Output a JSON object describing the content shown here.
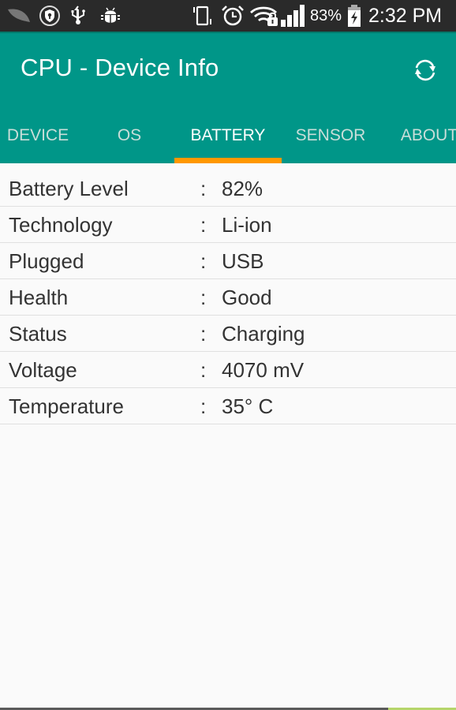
{
  "status_bar": {
    "left_icons": [
      "leaf-icon",
      "shield-lock-icon",
      "usb-icon",
      "android-debug-icon"
    ],
    "right_icons": [
      "vibrate-icon",
      "alarm-icon",
      "wifi-locked-icon",
      "signal-icon"
    ],
    "battery_percent": "83%",
    "battery_icon": "battery-charging-icon",
    "time": "2:32 PM"
  },
  "app_bar": {
    "title": "CPU - Device Info",
    "refresh_icon": "refresh-icon",
    "background_color": "#009688",
    "accent_color": "#ff9800"
  },
  "tabs": [
    {
      "label": "DEVICE",
      "active": false
    },
    {
      "label": "OS",
      "active": false
    },
    {
      "label": "BATTERY",
      "active": true
    },
    {
      "label": "SENSOR",
      "active": false
    },
    {
      "label": "ABOUT",
      "active": false
    }
  ],
  "battery_info": {
    "separator": ":",
    "rows": [
      {
        "label": "Battery Level",
        "value": "82%"
      },
      {
        "label": "Technology",
        "value": "Li-ion"
      },
      {
        "label": "Plugged",
        "value": "USB"
      },
      {
        "label": "Health",
        "value": "Good"
      },
      {
        "label": "Status",
        "value": "Charging"
      },
      {
        "label": "Voltage",
        "value": "4070 mV"
      },
      {
        "label": "Temperature",
        "value": "35° C"
      }
    ]
  }
}
